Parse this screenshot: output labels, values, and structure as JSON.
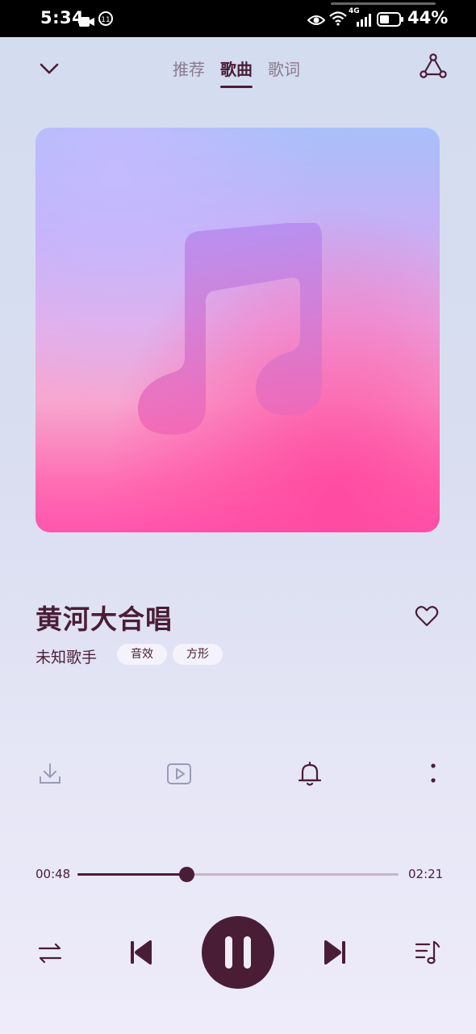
{
  "status_bar": {
    "time": "5:34",
    "network": "4G",
    "battery_percent": "44%",
    "icons": [
      "video-camera-icon",
      "data-saver-icon",
      "eye-comfort-icon",
      "wifi-icon",
      "signal-icon",
      "battery-icon"
    ]
  },
  "nav": {
    "tabs": [
      {
        "label": "推荐",
        "active": false
      },
      {
        "label": "歌曲",
        "active": true
      },
      {
        "label": "歌词",
        "active": false
      }
    ],
    "back_icon": "chevron-down-icon",
    "share_icon": "share-icon"
  },
  "cover": {
    "icon": "music-note-icon"
  },
  "song": {
    "title": "黄河大合唱",
    "artist": "未知歌手",
    "tags": [
      "音效",
      "方形"
    ],
    "favorite_icon": "heart-icon"
  },
  "actions": [
    "download-icon",
    "music-video-icon",
    "ringtone-bell-icon",
    "more-icon"
  ],
  "playback": {
    "current_time": "00:48",
    "total_time": "02:21",
    "progress_fraction": 0.34,
    "state": "playing"
  },
  "colors": {
    "accent": "#4a1d36",
    "inactive": "#8c7a8e",
    "track": "#c4b6c8"
  }
}
